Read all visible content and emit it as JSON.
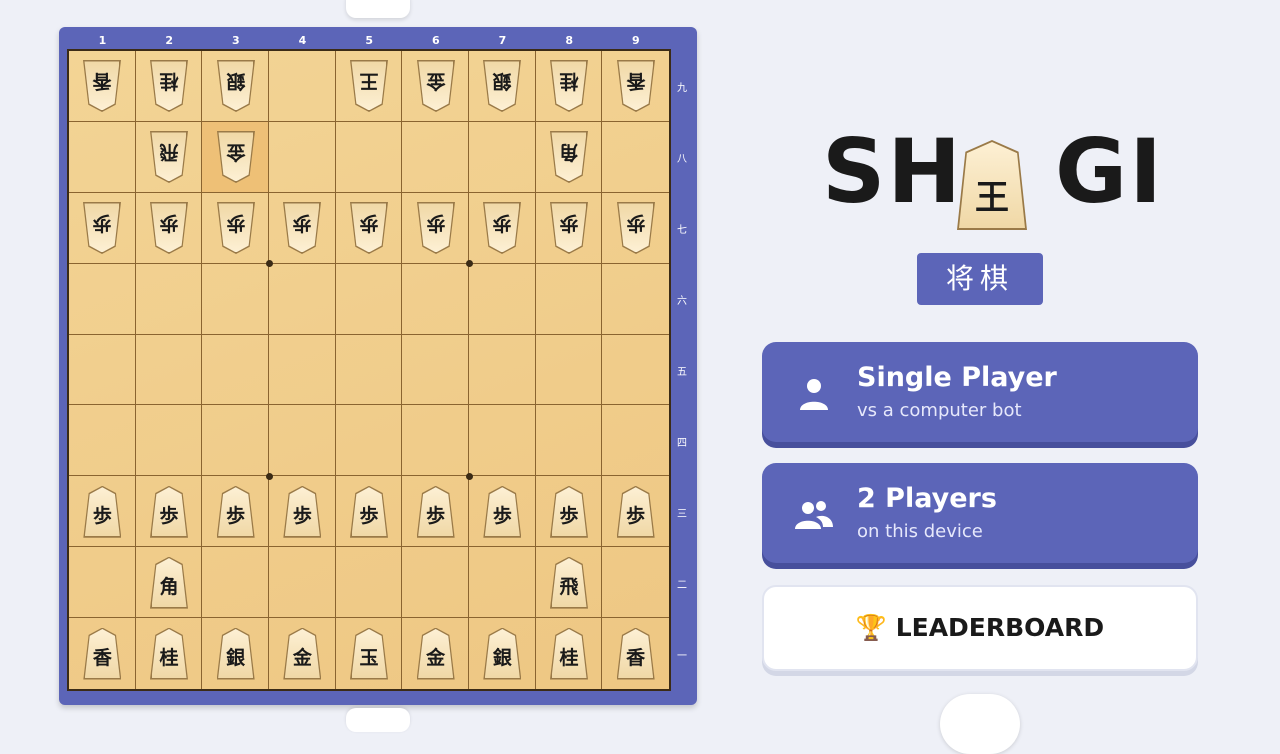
{
  "app": {
    "title_left": "SH",
    "title_right": "GI",
    "logo_piece": "王",
    "subtitle": "将棋"
  },
  "menu": {
    "single_player": {
      "label": "Single Player",
      "sub": "vs a computer bot",
      "icon": "person-icon"
    },
    "two_players": {
      "label": "2 Players",
      "sub": "on this device",
      "icon": "people-icon"
    },
    "leaderboard": {
      "label": "🏆 LEADERBOARD"
    }
  },
  "board": {
    "files": [
      "1",
      "2",
      "3",
      "4",
      "5",
      "6",
      "7",
      "8",
      "9"
    ],
    "ranks": [
      "九",
      "八",
      "七",
      "六",
      "五",
      "四",
      "三",
      "二",
      "一"
    ],
    "highlight": {
      "row": 1,
      "col": 2
    },
    "pieces": [
      {
        "r": 0,
        "c": 0,
        "ch": "香",
        "down": true
      },
      {
        "r": 0,
        "c": 1,
        "ch": "桂",
        "down": true
      },
      {
        "r": 0,
        "c": 2,
        "ch": "銀",
        "down": true
      },
      {
        "r": 0,
        "c": 4,
        "ch": "王",
        "down": true
      },
      {
        "r": 0,
        "c": 5,
        "ch": "金",
        "down": true
      },
      {
        "r": 0,
        "c": 6,
        "ch": "銀",
        "down": true
      },
      {
        "r": 0,
        "c": 7,
        "ch": "桂",
        "down": true
      },
      {
        "r": 0,
        "c": 8,
        "ch": "香",
        "down": true
      },
      {
        "r": 1,
        "c": 1,
        "ch": "飛",
        "down": true
      },
      {
        "r": 1,
        "c": 2,
        "ch": "金",
        "down": true
      },
      {
        "r": 1,
        "c": 7,
        "ch": "角",
        "down": true
      },
      {
        "r": 2,
        "c": 0,
        "ch": "歩",
        "down": true
      },
      {
        "r": 2,
        "c": 1,
        "ch": "歩",
        "down": true
      },
      {
        "r": 2,
        "c": 2,
        "ch": "歩",
        "down": true
      },
      {
        "r": 2,
        "c": 3,
        "ch": "歩",
        "down": true
      },
      {
        "r": 2,
        "c": 4,
        "ch": "歩",
        "down": true
      },
      {
        "r": 2,
        "c": 5,
        "ch": "歩",
        "down": true
      },
      {
        "r": 2,
        "c": 6,
        "ch": "歩",
        "down": true
      },
      {
        "r": 2,
        "c": 7,
        "ch": "歩",
        "down": true
      },
      {
        "r": 2,
        "c": 8,
        "ch": "歩",
        "down": true
      },
      {
        "r": 6,
        "c": 0,
        "ch": "歩",
        "down": false
      },
      {
        "r": 6,
        "c": 1,
        "ch": "歩",
        "down": false
      },
      {
        "r": 6,
        "c": 2,
        "ch": "歩",
        "down": false
      },
      {
        "r": 6,
        "c": 3,
        "ch": "歩",
        "down": false
      },
      {
        "r": 6,
        "c": 4,
        "ch": "歩",
        "down": false
      },
      {
        "r": 6,
        "c": 5,
        "ch": "歩",
        "down": false
      },
      {
        "r": 6,
        "c": 6,
        "ch": "歩",
        "down": false
      },
      {
        "r": 6,
        "c": 7,
        "ch": "歩",
        "down": false
      },
      {
        "r": 6,
        "c": 8,
        "ch": "歩",
        "down": false
      },
      {
        "r": 7,
        "c": 1,
        "ch": "角",
        "down": false
      },
      {
        "r": 7,
        "c": 7,
        "ch": "飛",
        "down": false
      },
      {
        "r": 8,
        "c": 0,
        "ch": "香",
        "down": false
      },
      {
        "r": 8,
        "c": 1,
        "ch": "桂",
        "down": false
      },
      {
        "r": 8,
        "c": 2,
        "ch": "銀",
        "down": false
      },
      {
        "r": 8,
        "c": 3,
        "ch": "金",
        "down": false
      },
      {
        "r": 8,
        "c": 4,
        "ch": "玉",
        "down": false
      },
      {
        "r": 8,
        "c": 5,
        "ch": "金",
        "down": false
      },
      {
        "r": 8,
        "c": 6,
        "ch": "銀",
        "down": false
      },
      {
        "r": 8,
        "c": 7,
        "ch": "桂",
        "down": false
      },
      {
        "r": 8,
        "c": 8,
        "ch": "香",
        "down": false
      }
    ]
  },
  "colors": {
    "accent": "#5c65b8",
    "board": "#f1cf8e",
    "highlight": "#e8a046"
  }
}
